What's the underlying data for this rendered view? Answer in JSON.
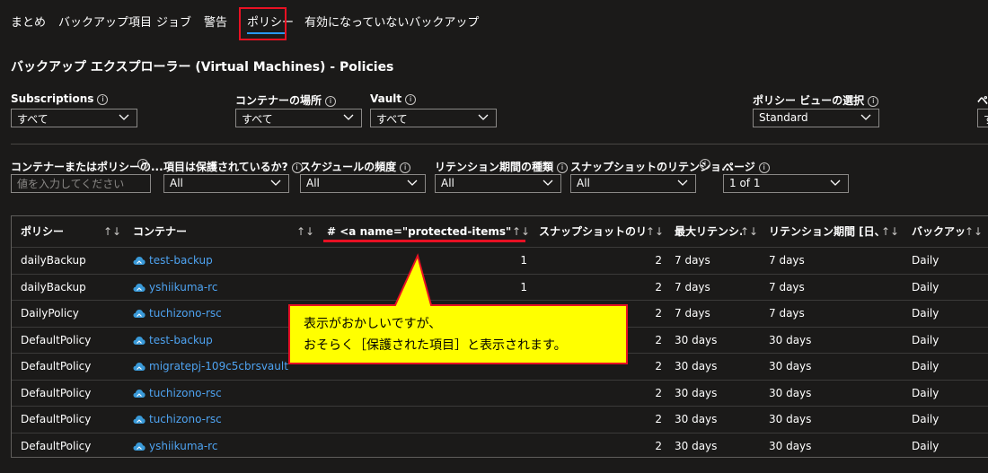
{
  "nav": {
    "items": [
      {
        "label": "まとめ"
      },
      {
        "label": "バックアップ項目"
      },
      {
        "label": "ジョブ"
      },
      {
        "label": "警告"
      },
      {
        "label": "ポリシー"
      },
      {
        "label": "有効になっていないバックアップ"
      }
    ],
    "active_index": 4
  },
  "page_title": "バックアップ エクスプローラー (Virtual Machines) - Policies",
  "filters_row1": {
    "subscriptions": {
      "label": "Subscriptions",
      "value": "すべて"
    },
    "container_location": {
      "label": "コンテナーの場所",
      "value": "すべて"
    },
    "vault": {
      "label": "Vault",
      "value": "すべて"
    },
    "policy_view": {
      "label": "ポリシー ビューの選択",
      "value": "Standard"
    },
    "cut_label": "ペ",
    "cut_value": "す"
  },
  "filters_row2": {
    "search": {
      "label": "コンテナーまたはポリシーの...",
      "placeholder": "値を入力してください"
    },
    "protected": {
      "label": "項目は保護されているか?",
      "value": "All"
    },
    "schedule": {
      "label": "スケジュールの頻度",
      "value": "All"
    },
    "retention_type": {
      "label": "リテンション期間の種類",
      "value": "All"
    },
    "snapshot_retention": {
      "label": "スナップショットのリテンショ...",
      "value": "All"
    },
    "page": {
      "label": "ページ",
      "value": "1 of 1"
    }
  },
  "grid": {
    "columns": [
      {
        "label": "ポリシー",
        "sort": "↑↓"
      },
      {
        "label": "コンテナー",
        "sort": "↑↓"
      },
      {
        "label": "# <a name=\"protected-items\"></a...",
        "sort": "↑↓"
      },
      {
        "label": "スナップショットのリテン...",
        "sort": "↑↓"
      },
      {
        "label": "最大リテンシ...",
        "sort": "↑↓"
      },
      {
        "label": "リテンション期間 [日、...",
        "sort": "↑↓"
      },
      {
        "label": "バックアッ...",
        "sort": "↑↓"
      }
    ],
    "rows": [
      {
        "policy": "dailyBackup",
        "container": "test-backup",
        "protected": "1",
        "snapshot": "2",
        "max_retention": "7 days",
        "retention": "7 days",
        "backup": "Daily"
      },
      {
        "policy": "dailyBackup",
        "container": "yshiikuma-rc",
        "protected": "1",
        "snapshot": "2",
        "max_retention": "7 days",
        "retention": "7 days",
        "backup": "Daily"
      },
      {
        "policy": "DailyPolicy",
        "container": "tuchizono-rsc",
        "protected": "",
        "snapshot": "2",
        "max_retention": "7 days",
        "retention": "7 days",
        "backup": "Daily"
      },
      {
        "policy": "DefaultPolicy",
        "container": "test-backup",
        "protected": "",
        "snapshot": "2",
        "max_retention": "30 days",
        "retention": "30 days",
        "backup": "Daily"
      },
      {
        "policy": "DefaultPolicy",
        "container": "migratepj-109c5cbrsvault",
        "protected": "",
        "snapshot": "2",
        "max_retention": "30 days",
        "retention": "30 days",
        "backup": "Daily"
      },
      {
        "policy": "DefaultPolicy",
        "container": "tuchizono-rsc",
        "protected": "",
        "snapshot": "2",
        "max_retention": "30 days",
        "retention": "30 days",
        "backup": "Daily"
      },
      {
        "policy": "DefaultPolicy",
        "container": "tuchizono-rsc",
        "protected": "",
        "snapshot": "2",
        "max_retention": "30 days",
        "retention": "30 days",
        "backup": "Daily"
      },
      {
        "policy": "DefaultPolicy",
        "container": "yshiikuma-rc",
        "protected": "",
        "snapshot": "2",
        "max_retention": "30 days",
        "retention": "30 days",
        "backup": "Daily"
      }
    ]
  },
  "annotation": {
    "line1": "表示がおかしいですが、",
    "line2": "おそらく［保護された項目］と表示されます。"
  },
  "icons": {
    "info": "info-icon",
    "chevron": "chevron-down-icon",
    "cloud": "recovery-vault-cloud-icon"
  },
  "colors": {
    "background": "#1b1a19",
    "link": "#4ea3f1",
    "accent": "#2899f5",
    "highlight_red": "#e81123",
    "callout_fill": "#ffff00"
  }
}
